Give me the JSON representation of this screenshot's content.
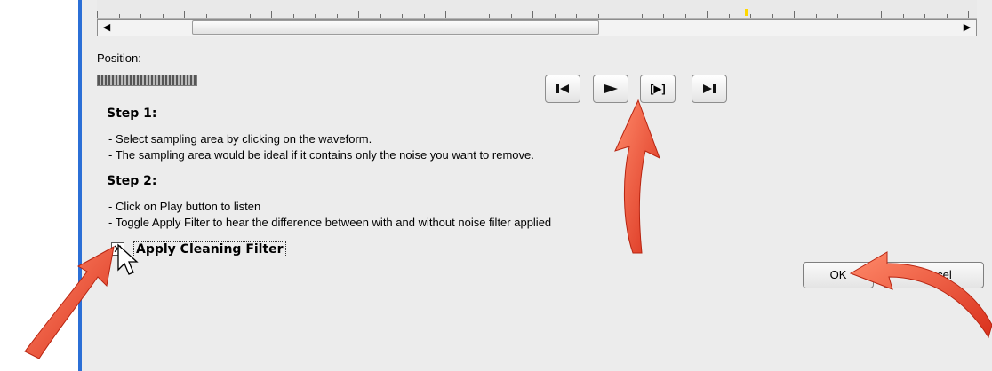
{
  "position": {
    "label": "Position:"
  },
  "transport": {
    "skip_start": {
      "icon": "skip-to-start-icon",
      "glyph": "I◀"
    },
    "play": {
      "icon": "play-icon",
      "glyph": "▶"
    },
    "play_selection": {
      "icon": "play-selection-icon",
      "glyph": "[▶]"
    },
    "skip_end": {
      "icon": "skip-to-end-icon",
      "glyph": "▶I"
    }
  },
  "instructions": {
    "step1": {
      "title": "Step 1:",
      "lines": [
        "- Select sampling area by clicking on the waveform.",
        "- The sampling area would be ideal if it contains only the noise you want to remove."
      ]
    },
    "step2": {
      "title": "Step 2:",
      "lines": [
        "- Click on Play button to listen",
        "- Toggle Apply Filter to hear the difference between with and without noise filter applied"
      ]
    }
  },
  "filter": {
    "label": "Apply Cleaning Filter",
    "checked": true,
    "check_glyph": "✕"
  },
  "buttons": {
    "ok": "OK",
    "cancel": "Cancel"
  },
  "scroll": {
    "left_arrow": "◀",
    "right_arrow": "▶"
  },
  "colors": {
    "arrow": "#e8432e",
    "accent_border": "#2b6fd6"
  }
}
